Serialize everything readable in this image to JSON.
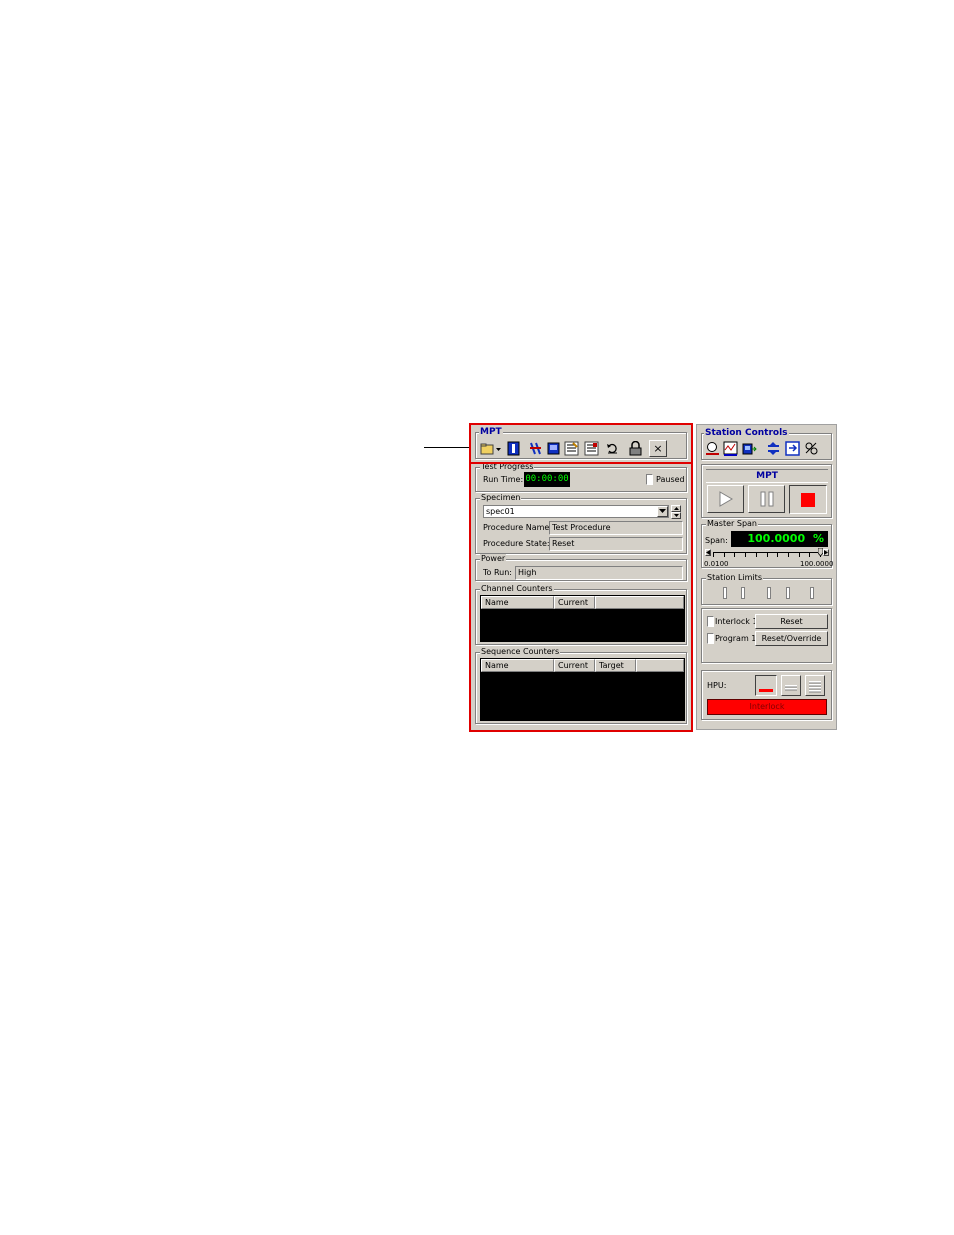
{
  "mpt": {
    "title": "MPT",
    "toolbar": [
      {
        "icon": "open-folder-icon"
      },
      {
        "icon": "dropdown-arrow-icon"
      },
      {
        "icon": "info-icon"
      },
      {
        "icon": "edit-procedure-icon"
      },
      {
        "icon": "specimen-icon"
      },
      {
        "icon": "log-icon"
      },
      {
        "icon": "report-icon"
      },
      {
        "icon": "reset-icon"
      },
      {
        "icon": "lock-icon"
      },
      {
        "icon": "close-icon",
        "glyph": "×"
      }
    ],
    "test_progress": {
      "label": "Test Progress",
      "run_time_label": "Run Time:",
      "run_time_value": "00:00:00",
      "paused_label": "Paused"
    },
    "specimen": {
      "label": "Specimen",
      "selected": "spec01",
      "procedure_name_label": "Procedure Name:",
      "procedure_name_value": "Test Procedure",
      "procedure_state_label": "Procedure State:",
      "procedure_state_value": "Reset"
    },
    "power": {
      "label": "Power",
      "to_run_label": "To Run:",
      "to_run_value": "High"
    },
    "channel_counters": {
      "label": "Channel Counters",
      "columns": [
        "Name",
        "Current"
      ]
    },
    "sequence_counters": {
      "label": "Sequence Counters",
      "columns": [
        "Name",
        "Current",
        "Target"
      ]
    }
  },
  "station": {
    "title": "Station Controls",
    "toolbar": [
      {
        "icon": "station-setup-icon"
      },
      {
        "icon": "scope-icon"
      },
      {
        "icon": "meters-icon"
      },
      {
        "icon": "signals-icon"
      },
      {
        "icon": "exit-icon"
      },
      {
        "icon": "manual-command-icon"
      }
    ],
    "program_label": "MPT",
    "master_span": {
      "label": "Master Span",
      "span_label": "Span:",
      "span_value": "100.0000",
      "span_unit": "%",
      "slider_min": "0.0100",
      "slider_max": "100.0000",
      "slider_level": 1.0
    },
    "station_limits": {
      "label": "Station Limits"
    },
    "interlock_rows": [
      {
        "label": "Interlock 1",
        "button": "Reset"
      },
      {
        "label": "Program 1",
        "button": "Reset/Override"
      }
    ],
    "hpu": {
      "label": "HPU:",
      "status": "Interlock",
      "status_color": "#ff0000"
    }
  }
}
